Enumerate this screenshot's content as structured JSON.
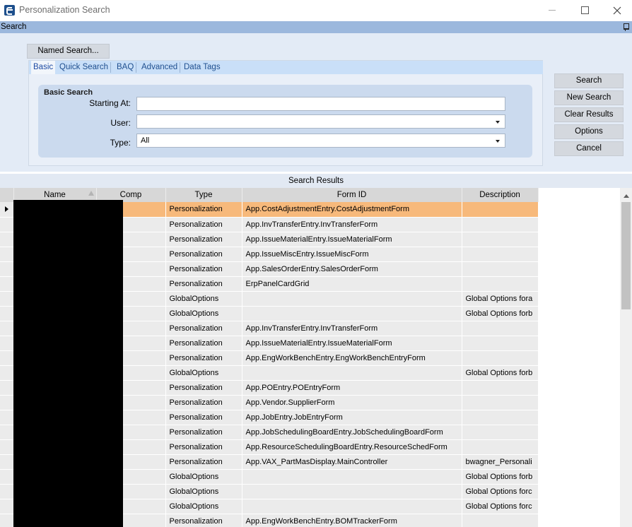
{
  "window": {
    "title": "Personalization Search"
  },
  "search_bar": {
    "title": "Search"
  },
  "named_search": {
    "label": "Named Search..."
  },
  "tabs": [
    {
      "label": "Basic"
    },
    {
      "label": "Quick Search"
    },
    {
      "label": "BAQ"
    },
    {
      "label": "Advanced"
    },
    {
      "label": "Data Tags"
    }
  ],
  "basic_search": {
    "title": "Basic Search",
    "starting_at_label": "Starting At:",
    "starting_at_value": "",
    "user_label": "User:",
    "user_value": "",
    "type_label": "Type:",
    "type_value": "All"
  },
  "actions": {
    "search": "Search",
    "new_search": "New Search",
    "clear_results": "Clear Results",
    "options": "Options",
    "cancel": "Cancel"
  },
  "results": {
    "title": "Search Results",
    "columns": [
      "Name",
      "Comp",
      "Type",
      "Form ID",
      "Description"
    ],
    "rows": [
      {
        "type": "Personalization",
        "form_id": "App.CostAdjustmentEntry.CostAdjustmentForm",
        "description": ""
      },
      {
        "type": "Personalization",
        "form_id": "App.InvTransferEntry.InvTransferForm",
        "description": ""
      },
      {
        "type": "Personalization",
        "form_id": "App.IssueMaterialEntry.IssueMaterialForm",
        "description": ""
      },
      {
        "type": "Personalization",
        "form_id": "App.IssueMiscEntry.IssueMiscForm",
        "description": ""
      },
      {
        "type": "Personalization",
        "form_id": "App.SalesOrderEntry.SalesOrderForm",
        "description": ""
      },
      {
        "type": "Personalization",
        "form_id": "ErpPanelCardGrid",
        "description": ""
      },
      {
        "type": "GlobalOptions",
        "form_id": "",
        "description": "Global Options fora"
      },
      {
        "type": "GlobalOptions",
        "form_id": "",
        "description": "Global Options forb"
      },
      {
        "type": "Personalization",
        "form_id": "App.InvTransferEntry.InvTransferForm",
        "description": ""
      },
      {
        "type": "Personalization",
        "form_id": "App.IssueMaterialEntry.IssueMaterialForm",
        "description": ""
      },
      {
        "type": "Personalization",
        "form_id": "App.EngWorkBenchEntry.EngWorkBenchEntryForm",
        "description": ""
      },
      {
        "type": "GlobalOptions",
        "form_id": "",
        "description": "Global Options forb"
      },
      {
        "type": "Personalization",
        "form_id": "App.POEntry.POEntryForm",
        "description": ""
      },
      {
        "type": "Personalization",
        "form_id": "App.Vendor.SupplierForm",
        "description": ""
      },
      {
        "type": "Personalization",
        "form_id": "App.JobEntry.JobEntryForm",
        "description": ""
      },
      {
        "type": "Personalization",
        "form_id": "App.JobSchedulingBoardEntry.JobSchedulingBoardForm",
        "description": ""
      },
      {
        "type": "Personalization",
        "form_id": "App.ResourceSchedulingBoardEntry.ResourceSchedForm",
        "description": ""
      },
      {
        "type": "Personalization",
        "form_id": "App.VAX_PartMasDisplay.MainController",
        "description": "bwagner_Personali"
      },
      {
        "type": "GlobalOptions",
        "form_id": "",
        "description": "Global Options forb"
      },
      {
        "type": "GlobalOptions",
        "form_id": "",
        "description": "Global Options forc"
      },
      {
        "type": "GlobalOptions",
        "form_id": "",
        "description": "Global Options forc"
      },
      {
        "type": "Personalization",
        "form_id": "App.EngWorkBenchEntry.BOMTrackerForm",
        "description": ""
      }
    ],
    "selected_row": 0
  },
  "colors": {
    "selected_row": "#f7b97b",
    "header_bar": "#9cb8dd",
    "panel_bg": "#e3ebf6"
  }
}
